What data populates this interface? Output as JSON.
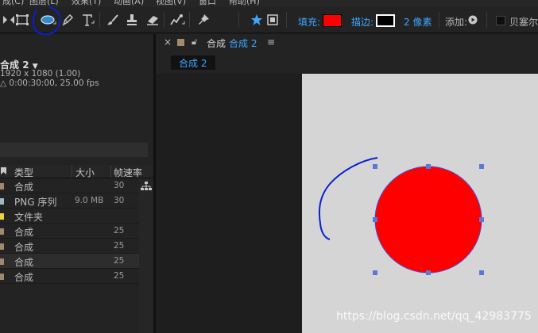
{
  "menubar": {
    "items": [
      "成(C)",
      "图层(L)",
      "效果(T)",
      "动画(A)",
      "视图(V)",
      "窗口",
      "帮助(H)"
    ]
  },
  "toolbar": {
    "tools": [
      {
        "name": "pan-behind-tool",
        "icon": "pan-behind-icon"
      },
      {
        "name": "rectangle-tool",
        "icon": "rectangle-icon"
      },
      {
        "name": "ellipse-tool",
        "icon": "ellipse-icon",
        "active": true
      },
      {
        "name": "pen-tool",
        "icon": "pen-icon"
      },
      {
        "name": "type-tool",
        "icon": "type-icon"
      },
      {
        "name": "brush-tool",
        "icon": "brush-icon"
      },
      {
        "name": "clone-stamp-tool",
        "icon": "stamp-icon"
      },
      {
        "name": "eraser-tool",
        "icon": "eraser-icon"
      },
      {
        "name": "roto-brush-tool",
        "icon": "roto-brush-icon"
      },
      {
        "name": "puppet-pin-tool",
        "icon": "pin-icon"
      }
    ],
    "fill_label": "填充:",
    "stroke_label": "描边:",
    "stroke_width": "2 像素",
    "add_label": "添加:",
    "bezier_label": "贝塞尔",
    "fill_color": "#ff0000",
    "stroke_color": "#000000"
  },
  "project": {
    "comp_name": "合成",
    "comp_number": "2",
    "comp_dims": "1920 x 1080 (1.00)",
    "comp_duration": "△ 0:00:30:00, 25.00 fps",
    "columns": {
      "type": "类型",
      "size": "大小",
      "fps": "帧速率"
    },
    "rows": [
      {
        "swatch": "#a08a6c",
        "type": "合成",
        "size": "",
        "fps": "30"
      },
      {
        "swatch": "#9fb7c4",
        "type": "PNG 序列",
        "size": "9.0 MB",
        "fps": "30"
      },
      {
        "swatch": "#e8d33a",
        "type": "文件夹",
        "size": "",
        "fps": ""
      },
      {
        "swatch": "#a08a6c",
        "type": "合成",
        "size": "",
        "fps": "25"
      },
      {
        "swatch": "#a08a6c",
        "type": "合成",
        "size": "",
        "fps": "25"
      },
      {
        "swatch": "#a08a6c",
        "type": "合成",
        "size": "",
        "fps": "25",
        "selected": true
      },
      {
        "swatch": "#a08a6c",
        "type": "合成",
        "size": "",
        "fps": "25"
      }
    ]
  },
  "composition_panel": {
    "tab_label": "合成",
    "tab_comp": "合成 2",
    "subtab": "合成 2",
    "shape_fill": "#ff0000",
    "shape_stroke": "#4a4ad8",
    "handle_color": "#5b78d8"
  },
  "watermark": "https://blog.csdn.net/qq_42983775",
  "annotation_color": "#0a1fd1"
}
